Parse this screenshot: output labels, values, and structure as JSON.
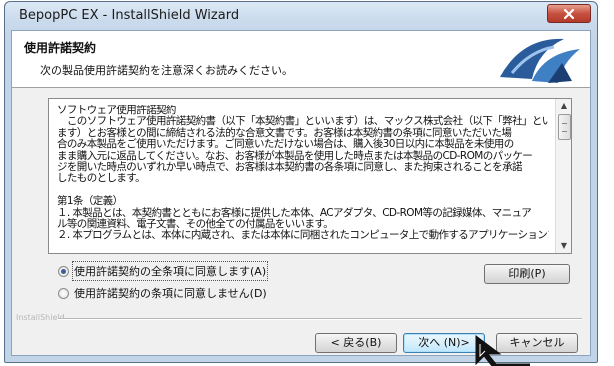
{
  "window": {
    "title": "BepopPC EX - InstallShield Wizard",
    "close_glyph": "✕"
  },
  "header": {
    "title": "使用許諾契約",
    "subtitle": "次の製品使用許諾契約を注意深くお読みください。"
  },
  "license": {
    "text": "ソフトウェア使用許諾契約\n　このソフトウェア使用許諾契約書（以下「本契約書」といいます）は、マックス株式会社（以下「弊社」といい\nます）とお客様との間に締結される法的な合意文書です。お客様は本契約書の条項に同意いただいた場\n合のみ本製品をご使用いただけます。ご同意いただけない場合は、購入後30日以内に本製品を未使用の\nまま購入元に返品してください。なお、お客様が本製品を使用した時点または本製品のCD-ROMのパッケー\nジを開いた時点のいずれか早い時点で、お客様は本契約書の各条項に同意し、また拘束されることを承諾\nしたものとします。\n\n第1条（定義）\n１. 本製品とは、本契約書とともにお客様に提供した本体、ACアダプタ、CD-ROM等の記録媒体、マニュア\nル等の関連資料、電子文書、その他全ての付属品をいいます。\n２. 本プログラムとは、本体に内蔵され、または本体に同梱されたコンピュータ上で動作するアプリケーションソフト －"
  },
  "options": {
    "accept_label": "使用許諾契約の全条項に同意します(A)",
    "decline_label": "使用許諾契約の条項に同意しません(D)",
    "selected": "accept"
  },
  "buttons": {
    "print_label": "印刷(P)",
    "back_label": "< 戻る(B)",
    "next_label": "次へ (N)>",
    "cancel_label": "キャンセル"
  },
  "footer": {
    "brand": "InstallShield"
  },
  "colors": {
    "title_bar": "#c9daec",
    "close_button": "#c75140",
    "default_button_border": "#3c7fb1",
    "radio_dot": "#3b5f95"
  },
  "icons": {
    "close": "close-icon",
    "header_logo": "installshield-logo-icon",
    "scroll_up": "scroll-up-arrow-icon",
    "scroll_down": "scroll-down-arrow-icon",
    "cursor": "mouse-pointer-icon"
  }
}
